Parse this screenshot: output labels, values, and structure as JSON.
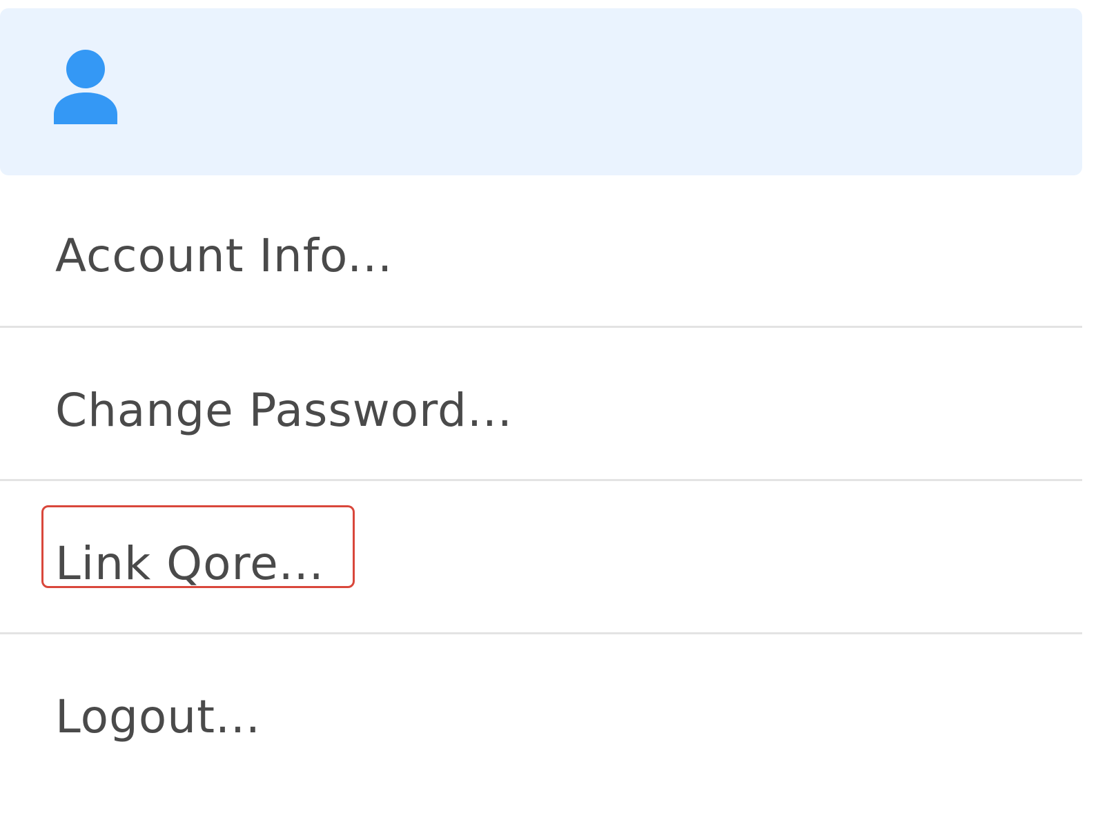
{
  "user_header": {
    "icon": "user-icon",
    "icon_color": "#3498f5",
    "background": "#eaf3fe"
  },
  "menu": {
    "items": [
      {
        "label": "Account Info..."
      },
      {
        "label": "Change Password..."
      },
      {
        "label": "Link Qore..."
      },
      {
        "label": "Logout..."
      }
    ]
  },
  "highlight": {
    "target": "Link Qore...",
    "color": "#d9473b"
  }
}
